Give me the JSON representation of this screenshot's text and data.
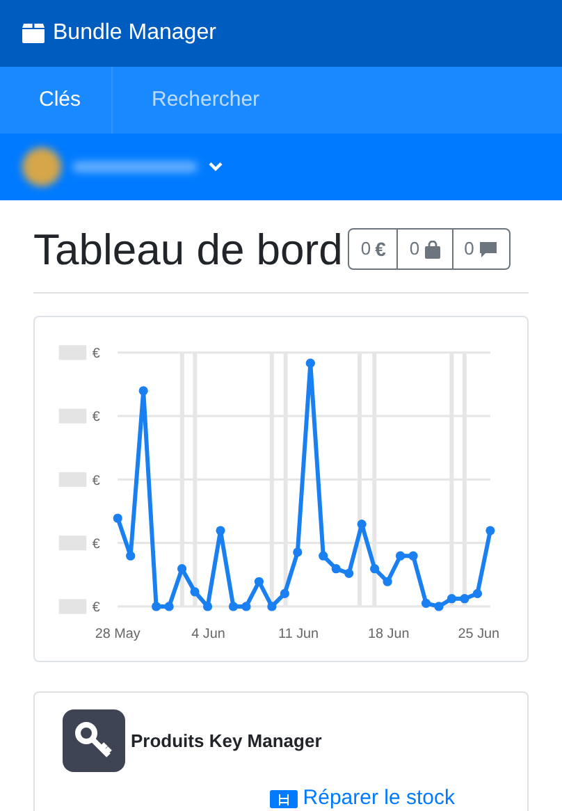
{
  "app": {
    "title": "Bundle Manager"
  },
  "nav": [
    {
      "label": "Clés",
      "selected": true
    },
    {
      "label": "Rechercher",
      "selected": false
    }
  ],
  "page": {
    "title": "Tableau de bord"
  },
  "counters": [
    {
      "kind": "money",
      "value": "0",
      "symbol": "€"
    },
    {
      "kind": "orders",
      "value": "0"
    },
    {
      "kind": "messages",
      "value": "0"
    }
  ],
  "chart": {
    "y_units": [
      "€",
      "€",
      "€",
      "€",
      "€"
    ],
    "x_labels": [
      "28 May",
      "4 Jun",
      "11 Jun",
      "18 Jun",
      "25 Jun"
    ]
  },
  "products_card": {
    "title": "Produits Key Manager",
    "action": "Réparer le stock"
  }
}
